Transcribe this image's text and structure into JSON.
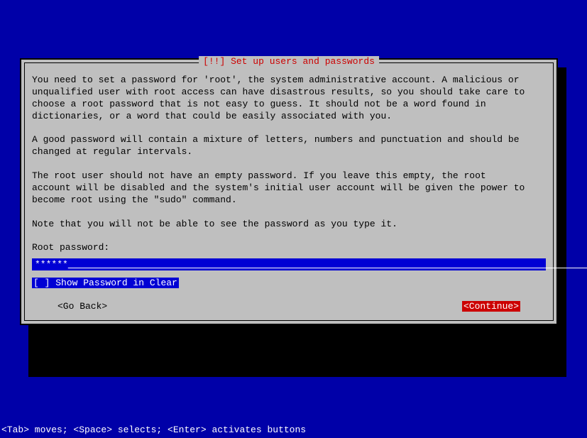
{
  "title": "[!!] Set up users and passwords",
  "body": "You need to set a password for 'root', the system administrative account. A malicious or\nunqualified user with root access can have disastrous results, so you should take care to\nchoose a root password that is not easy to guess. It should not be a word found in\ndictionaries, or a word that could be easily associated with you.\n\nA good password will contain a mixture of letters, numbers and punctuation and should be\nchanged at regular intervals.\n\nThe root user should not have an empty password. If you leave this empty, the root\naccount will be disabled and the system's initial user account will be given the power to\nbecome root using the \"sudo\" command.\n\nNote that you will not be able to see the password as you type it.\n\nRoot password:",
  "password": {
    "masked_value": "******"
  },
  "checkbox": {
    "checked": false,
    "label_prefix": "[ ] ",
    "label": "Show Password in Clear"
  },
  "buttons": {
    "go_back": "<Go Back>",
    "continue": "<Continue>"
  },
  "footer": "<Tab> moves; <Space> selects; <Enter> activates buttons"
}
